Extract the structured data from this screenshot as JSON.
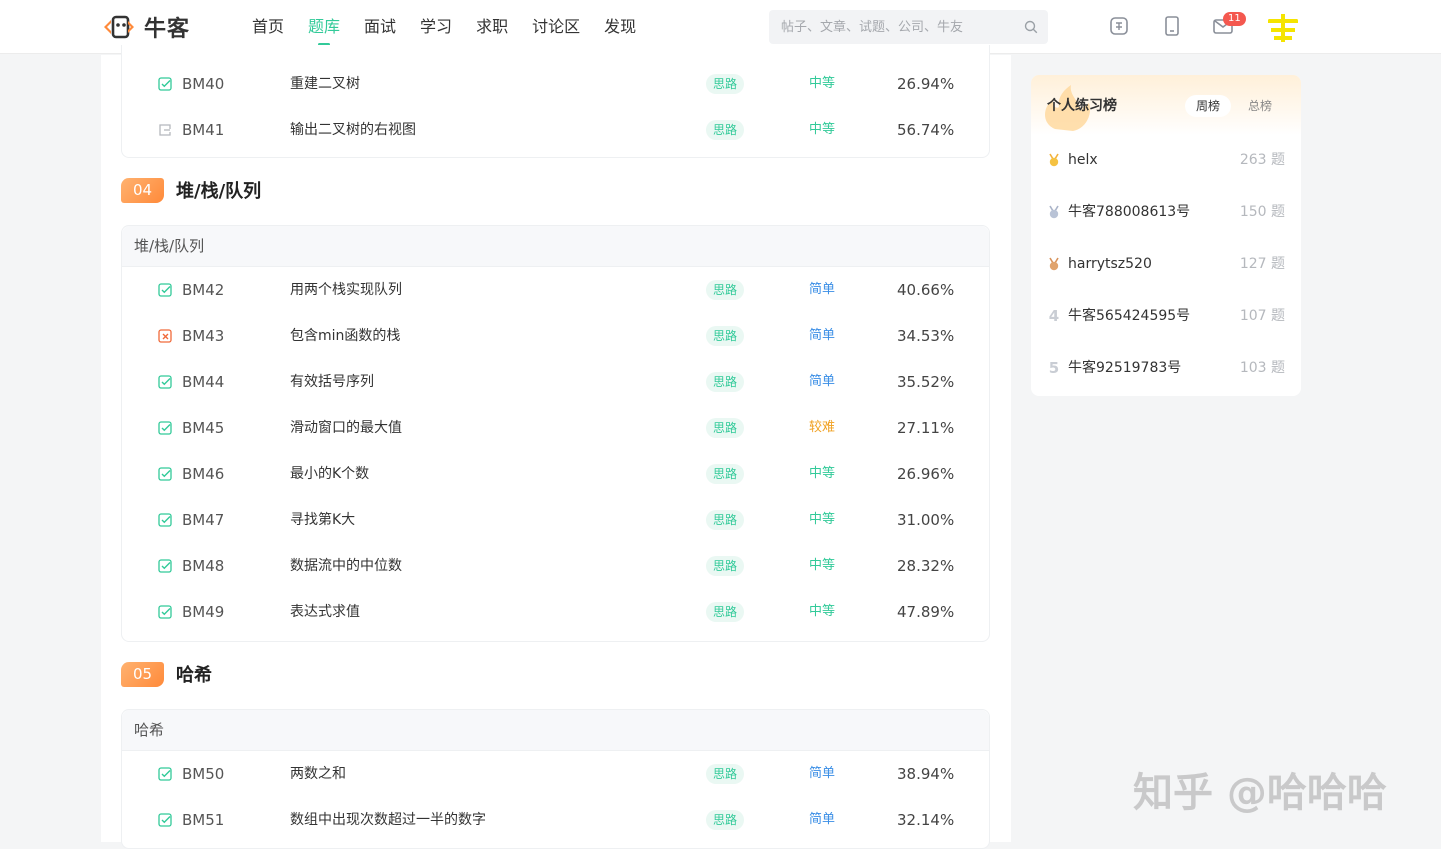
{
  "header": {
    "logo_text": "牛客",
    "nav": [
      {
        "label": "首页",
        "active": false
      },
      {
        "label": "题库",
        "active": true
      },
      {
        "label": "面试",
        "active": false
      },
      {
        "label": "学习",
        "active": false
      },
      {
        "label": "求职",
        "active": false
      },
      {
        "label": "讨论区",
        "active": false
      },
      {
        "label": "发现",
        "active": false
      }
    ],
    "search_placeholder": "帖子、文章、试题、公司、牛友",
    "message_count": "11"
  },
  "colors": {
    "accent": "#32ca99",
    "easy": "#3a8ee6",
    "medium": "#32ca99",
    "hard": "#f0a020",
    "section_badge": "#ff9a4d"
  },
  "problems_prev": [
    {
      "id": "BM40",
      "name": "重建二叉树",
      "hint": "思路",
      "difficulty": "中等",
      "rate": "26.94%",
      "status": "passed"
    },
    {
      "id": "BM41",
      "name": "输出二叉树的右视图",
      "hint": "思路",
      "difficulty": "中等",
      "rate": "56.74%",
      "status": "not-started"
    }
  ],
  "sections": [
    {
      "number": "04",
      "title": "堆/栈/队列",
      "subtitle": "堆/栈/队列",
      "problems": [
        {
          "id": "BM42",
          "name": "用两个栈实现队列",
          "hint": "思路",
          "difficulty": "简单",
          "level": "easy",
          "rate": "40.66%",
          "status": "passed"
        },
        {
          "id": "BM43",
          "name": "包含min函数的栈",
          "hint": "思路",
          "difficulty": "简单",
          "level": "easy",
          "rate": "34.53%",
          "status": "failed"
        },
        {
          "id": "BM44",
          "name": "有效括号序列",
          "hint": "思路",
          "difficulty": "简单",
          "level": "easy",
          "rate": "35.52%",
          "status": "passed"
        },
        {
          "id": "BM45",
          "name": "滑动窗口的最大值",
          "hint": "思路",
          "difficulty": "较难",
          "level": "hard",
          "rate": "27.11%",
          "status": "passed"
        },
        {
          "id": "BM46",
          "name": "最小的K个数",
          "hint": "思路",
          "difficulty": "中等",
          "level": "medium",
          "rate": "26.96%",
          "status": "passed"
        },
        {
          "id": "BM47",
          "name": "寻找第K大",
          "hint": "思路",
          "difficulty": "中等",
          "level": "medium",
          "rate": "31.00%",
          "status": "passed"
        },
        {
          "id": "BM48",
          "name": "数据流中的中位数",
          "hint": "思路",
          "difficulty": "中等",
          "level": "medium",
          "rate": "28.32%",
          "status": "passed"
        },
        {
          "id": "BM49",
          "name": "表达式求值",
          "hint": "思路",
          "difficulty": "中等",
          "level": "medium",
          "rate": "47.89%",
          "status": "passed"
        }
      ]
    },
    {
      "number": "05",
      "title": "哈希",
      "subtitle": "哈希",
      "problems": [
        {
          "id": "BM50",
          "name": "两数之和",
          "hint": "思路",
          "difficulty": "简单",
          "level": "easy",
          "rate": "38.94%",
          "status": "passed"
        },
        {
          "id": "BM51",
          "name": "数组中出现次数超过一半的数字",
          "hint": "思路",
          "difficulty": "简单",
          "level": "easy",
          "rate": "32.14%",
          "status": "passed"
        }
      ]
    }
  ],
  "ranking": {
    "title": "个人练习榜",
    "tabs": [
      {
        "label": "周榜",
        "active": true
      },
      {
        "label": "总榜",
        "active": false
      }
    ],
    "rows": [
      {
        "rank": "1",
        "name": "helx",
        "count": "263 题",
        "medal": "gold"
      },
      {
        "rank": "2",
        "name": "牛客788008613号",
        "count": "150 题",
        "medal": "silver"
      },
      {
        "rank": "3",
        "name": "harrytsz520",
        "count": "127 题",
        "medal": "bronze"
      },
      {
        "rank": "4",
        "name": "牛客565424595号",
        "count": "107 题",
        "medal": "none"
      },
      {
        "rank": "5",
        "name": "牛客92519783号",
        "count": "103 题",
        "medal": "none"
      }
    ]
  },
  "watermark": "知乎 @哈哈哈"
}
